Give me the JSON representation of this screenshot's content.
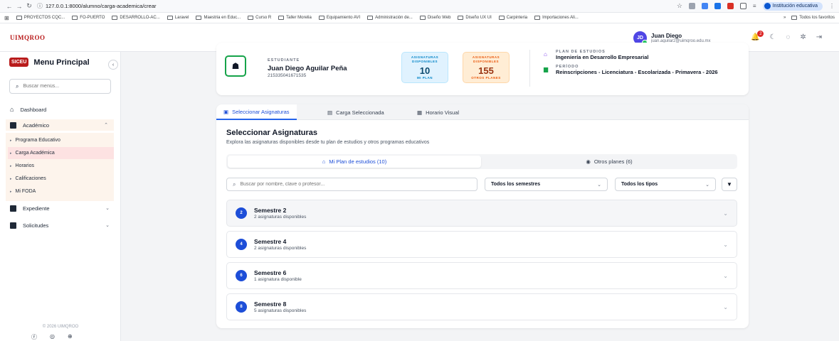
{
  "browser": {
    "url": "127.0.0.1:8000/alumno/carga-academica/crear",
    "profile": "Institución educativa",
    "bookmarks": [
      "PROYECTOS CQC...",
      "FO-PUERTO",
      "DESARROLLO-AC...",
      "Laravel",
      "Maestria en Educ...",
      "Curso R",
      "Taller Morelia",
      "Equipamiento AVI",
      "Administración de...",
      "Diseño Web",
      "Diseño UX UI",
      "Carpinteria",
      "Importaciones Ali..."
    ],
    "all_bookmarks": "Todos los favoritos"
  },
  "header": {
    "logo": "UIMQROO",
    "user_initials": "JD",
    "user_name": "Juan Diego",
    "user_email": "juan.aguilar2@uimqroo.edu.mx",
    "notification_count": "2"
  },
  "sidebar": {
    "badge": "SICEU",
    "title": "Menu Principal",
    "search_placeholder": "Buscar menús...",
    "dashboard": "Dashboard",
    "academico": "Académico",
    "sub_items": [
      "Programa Educativo",
      "Carga Académica",
      "Horarios",
      "Calificaciones",
      "Mi FODA"
    ],
    "expediente": "Expediente",
    "solicitudes": "Solicitudes",
    "footer": "© 2026 UIMQROO"
  },
  "student": {
    "label": "ESTUDIANTE",
    "name": "Juan Diego Aguilar Peña",
    "id": "215335041671535",
    "stat1_label": "ASIGNATURAS DISPONIBLES",
    "stat1_value": "10",
    "stat1_sub": "MI PLAN",
    "stat2_label": "ASIGNATURAS DISPONIBLES",
    "stat2_value": "155",
    "stat2_sub": "OTROS PLANES",
    "plan_label": "PLAN DE ESTUDIOS",
    "plan_value": "Ingeniería en Desarrollo Empresarial",
    "period_label": "PERÍODO",
    "period_value": "Reinscripciones - Licenciatura - Escolarizada - Primavera - 2026"
  },
  "tabs": [
    "Seleccionar Asignaturas",
    "Carga Seleccionada",
    "Horario Visual"
  ],
  "main": {
    "title": "Seleccionar Asignaturas",
    "subtitle": "Explora las asignaturas disponibles desde tu plan de estudios y otros programas educativos",
    "toggle_mine": "Mi Plan de estudios (10)",
    "toggle_other": "Otros planes (6)",
    "search_placeholder": "Buscar por nombre, clave o profesor...",
    "semester_select": "Todos los semestres",
    "type_select": "Todos los tipos"
  },
  "semesters": [
    {
      "num": "2",
      "title": "Semestre 2",
      "sub": "2 asignaturas disponibles"
    },
    {
      "num": "4",
      "title": "Semestre 4",
      "sub": "2 asignaturas disponibles"
    },
    {
      "num": "6",
      "title": "Semestre 6",
      "sub": "1 asignatura disponible"
    },
    {
      "num": "8",
      "title": "Semestre 8",
      "sub": "5 asignaturas disponibles"
    }
  ],
  "colors": {
    "accent": "#2563eb",
    "brand": "#b91c1c",
    "highlight": "#fde2e2"
  }
}
